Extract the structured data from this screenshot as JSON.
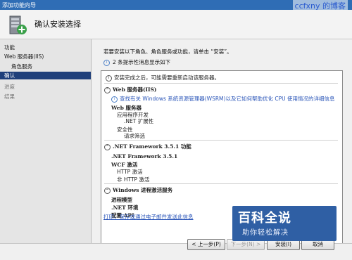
{
  "window": {
    "title": "添加功能向导"
  },
  "watermark": {
    "top_text": "ccfxny 的博客"
  },
  "header": {
    "title": "确认安装选择"
  },
  "nav": {
    "items": [
      {
        "label": "功能"
      },
      {
        "label": "Web 服务器(IIS)"
      },
      {
        "label": "角色服务"
      },
      {
        "label": "确认"
      },
      {
        "label": "进度"
      },
      {
        "label": "结果"
      }
    ]
  },
  "main": {
    "intro": "若要安装以下角色、角色服务或功能，请单击 “安装”。",
    "notice": "2 条提示性消息显示如下",
    "list": {
      "restart_notice": "安装完成之后，可能需要重新启动该服务器。",
      "sections": [
        {
          "title": "Web 服务器(IIS)",
          "link": "查找有关 Windows 系统资源管理器(WSRM)以及它如何帮助优化 CPU 使用情况的详细信息",
          "lines": [
            "Web 服务器",
            "应用程序开发",
            ".NET 扩展性",
            "安全性",
            "请求筛选"
          ]
        },
        {
          "title": ".NET Framework 3.5.1 功能",
          "lines": [
            ".NET Framework 3.5.1",
            "WCF 激活",
            "HTTP 激活",
            "非 HTTP 激活"
          ]
        },
        {
          "title": "Windows 进程激活服务",
          "lines": [
            "进程模型",
            ".NET 环境",
            "配置 API"
          ]
        }
      ]
    },
    "footer_link": "打印、保存或通过电子邮件发送此信息"
  },
  "buttons": {
    "prev": "< 上一步(P)",
    "next": "下一步(N) >",
    "install": "安装(I)",
    "cancel": "取消"
  },
  "brand": {
    "line1": "百科全说",
    "line2": "助你轻松解决"
  }
}
